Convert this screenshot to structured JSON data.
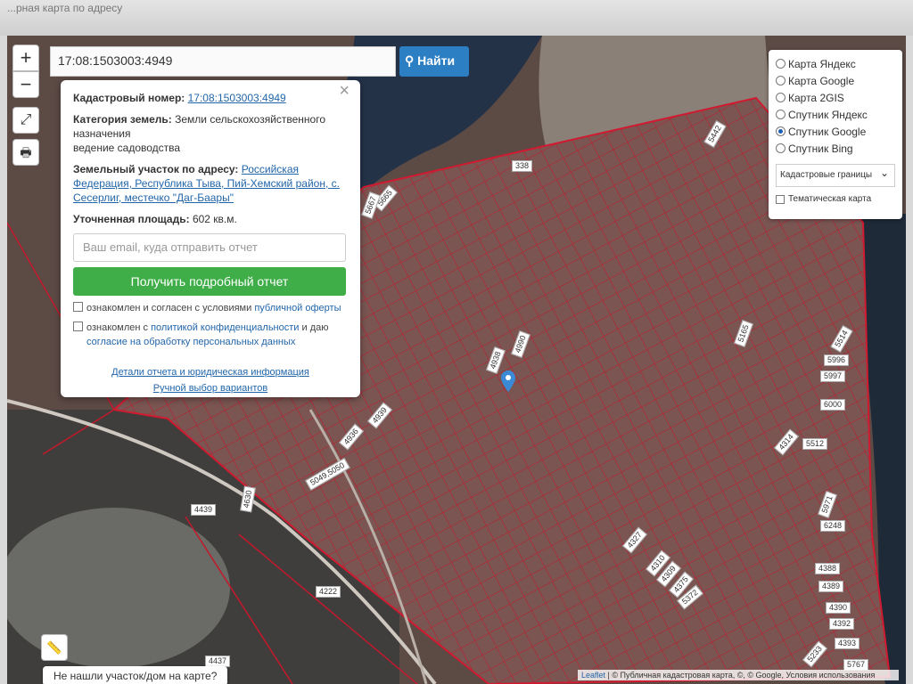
{
  "browser": {
    "tab_text": "...рная карта по адресу"
  },
  "controls": {
    "zoom_in": "+",
    "zoom_out": "−",
    "fullscreen": "⤢",
    "print": "🖶",
    "ruler": "📏"
  },
  "search": {
    "value": "17:08:1503003:4949",
    "button": "Найти"
  },
  "info": {
    "cad_label": "Кадастровый номер:",
    "cad_value": "17:08:1503003:4949",
    "cat_label": "Категория земель:",
    "cat_value": "Земли сельскохозяйственного назначения",
    "cat_use": "ведение садоводства",
    "addr_label": "Земельный участок по адресу:",
    "addr_value": "Российская Федерация, Республика Тыва, Пий-Хемский район, с. Сесерлиг, местечко \"Даг-Баары\"",
    "area_label": "Уточненная площадь:",
    "area_value": "602 кв.м.",
    "email_placeholder": "Ваш email, куда отправить отчет",
    "report_button": "Получить подробный отчет",
    "chk1_prefix": "ознакомлен и согласен с условиями ",
    "chk1_link": "публичной оферты",
    "chk2_prefix": "ознакомлен с ",
    "chk2_link": "политикой конфиденциальности",
    "chk2_mid": " и даю ",
    "chk2_link2": "согласие на обработку персональных данных",
    "link_details": "Детали отчета и юридическая информация",
    "link_manual": "Ручной выбор вариантов"
  },
  "layers": {
    "options": [
      "Карта Яндекс",
      "Карта Google",
      "Карта 2GIS",
      "Спутник Яндекс",
      "Спутник Google",
      "Спутник Bing"
    ],
    "selected": "Спутник Google",
    "select_value": "Кадастровые границы",
    "thematic": "Тематическая карта"
  },
  "parcel_labels": [
    "338",
    "5665",
    "5667",
    "5442",
    "4990",
    "4938",
    "5165",
    "5514",
    "5996",
    "5997",
    "6000",
    "5512",
    "4314",
    "5971",
    "6248",
    "4388",
    "4389",
    "4390",
    "4392",
    "4393",
    "5767",
    "5233",
    "4327",
    "4310",
    "4309",
    "4375",
    "5372",
    "4439",
    "4222",
    "4437",
    "4630",
    "5049,5050",
    "4936",
    "4939"
  ],
  "bottom": {
    "not_found": "Не нашли участок/дом на карте?",
    "attribution_leaflet": "Leaflet",
    "attribution_rest": " | © Публичная кадастровая карта, ©, © Google, Условия использования"
  }
}
